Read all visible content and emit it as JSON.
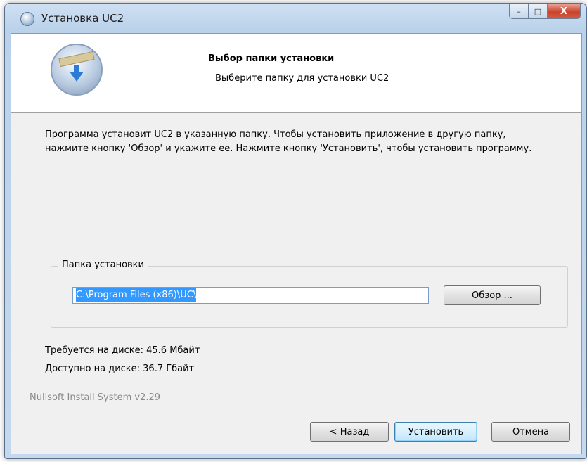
{
  "window": {
    "title": "Установка UC2",
    "controls": {
      "minimize": "–",
      "maximize": "□",
      "close": "X"
    }
  },
  "header": {
    "title": "Выбор папки установки",
    "subtitle": "Выберите папку для установки UC2"
  },
  "description": "Программа установит UC2 в указанную папку. Чтобы установить приложение в другую папку, нажмите кнопку 'Обзор' и укажите ее. Нажмите кнопку 'Установить', чтобы установить программу.",
  "folder_group": {
    "label": "Папка установки",
    "path_value": "C:\\Program Files (x86)\\UC\\",
    "browse_label": "Обзор ..."
  },
  "disk": {
    "required": "Требуется на диске: 45.6 Мбайт",
    "available": "Доступно на диске: 36.7 Гбайт"
  },
  "branding": "Nullsoft Install System v2.29",
  "buttons": {
    "back": "< Назад",
    "install": "Установить",
    "cancel": "Отмена"
  },
  "icons": {
    "title": "installer-globe-icon",
    "header": "install-disk-icon"
  }
}
